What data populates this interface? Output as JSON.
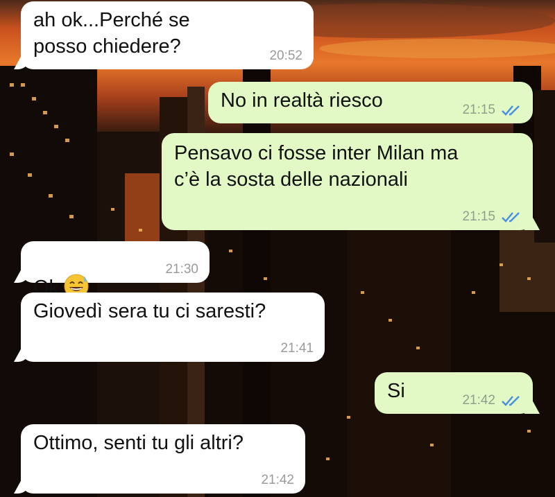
{
  "chat": {
    "messages": [
      {
        "direction": "incoming",
        "text": "ah ok...Perché se\nposso chiedere?",
        "time": "20:52"
      },
      {
        "direction": "outgoing",
        "text": "No in realtà riesco",
        "time": "21:15",
        "status": "read"
      },
      {
        "direction": "outgoing",
        "text": "Pensavo ci fosse inter Milan ma\nc’è la sosta delle nazionali",
        "time": "21:15",
        "status": "read"
      },
      {
        "direction": "incoming",
        "text": "Ok",
        "emoji": "grinning-sweat-emoji",
        "time": "21:30"
      },
      {
        "direction": "incoming",
        "text": "Giovedì sera tu ci saresti?",
        "time": "21:41"
      },
      {
        "direction": "outgoing",
        "text": "Si",
        "time": "21:42",
        "status": "read"
      },
      {
        "direction": "incoming",
        "text": "Ottimo, senti tu gli altri?",
        "time": "21:42"
      }
    ]
  },
  "colors": {
    "incoming_bubble": "#ffffff",
    "outgoing_bubble": "#e2f9c6",
    "read_check": "#4a90e2"
  },
  "icons": {
    "read_receipt": "double-check-icon",
    "background": "city-skyline-wallpaper"
  }
}
